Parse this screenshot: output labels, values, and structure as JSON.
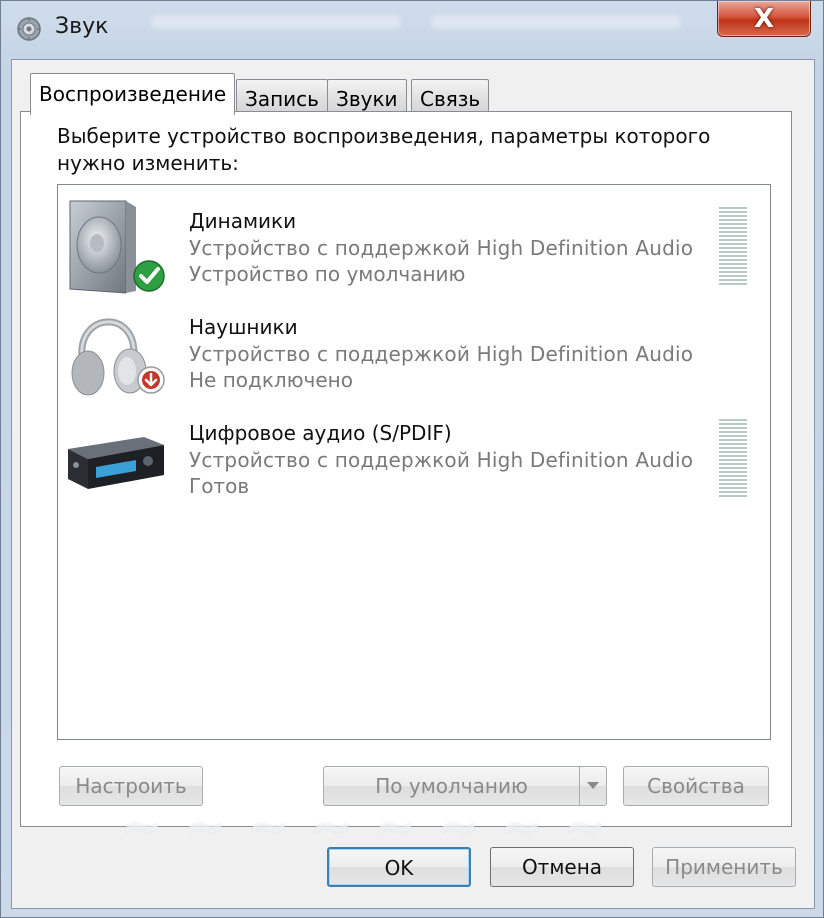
{
  "window": {
    "title": "Звук",
    "close_label": "X"
  },
  "tabs": [
    {
      "label": "Воспроизведение",
      "active": true
    },
    {
      "label": "Запись",
      "active": false
    },
    {
      "label": "Звуки",
      "active": false
    },
    {
      "label": "Связь",
      "active": false
    }
  ],
  "playback": {
    "instruction": "Выберите устройство воспроизведения, параметры которого нужно изменить:",
    "devices": [
      {
        "name": "Динамики",
        "description": "Устройство с поддержкой High Definition Audio",
        "status": "Устройство по умолчанию",
        "icon": "speaker-icon",
        "badge": "default-check-icon",
        "level_meter": true
      },
      {
        "name": "Наушники",
        "description": "Устройство с поддержкой High Definition Audio",
        "status": "Не подключено",
        "icon": "headphones-icon",
        "badge": "disconnected-arrow-icon",
        "level_meter": false
      },
      {
        "name": "Цифровое аудио (S/PDIF)",
        "description": "Устройство с поддержкой High Definition Audio",
        "status": "Готов",
        "icon": "digital-receiver-icon",
        "badge": null,
        "level_meter": true
      }
    ],
    "configure_label": "Настроить",
    "set_default_label": "По умолчанию",
    "properties_label": "Свойства"
  },
  "footer": {
    "ok_label": "OK",
    "cancel_label": "Отмена",
    "apply_label": "Применить"
  },
  "colors": {
    "default_badge": "#2ea043",
    "disconnected_badge": "#c0392b",
    "level_meter": "#b9c9c4"
  }
}
